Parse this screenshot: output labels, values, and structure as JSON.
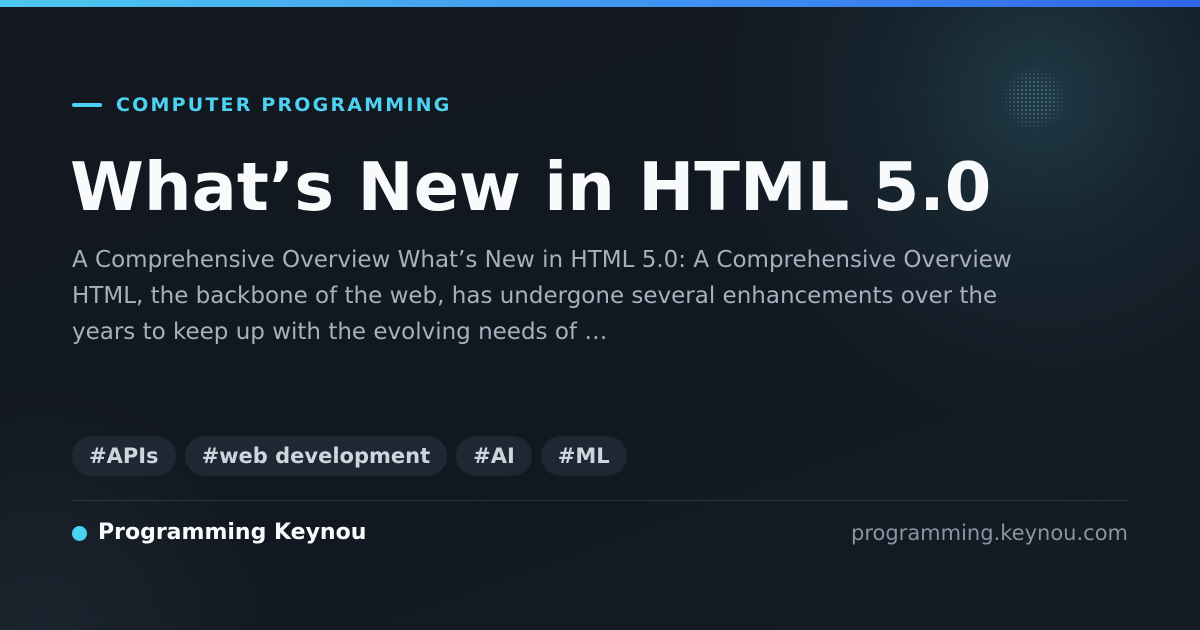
{
  "colors": {
    "background": "#121821",
    "accent": "#49d2f2",
    "top_bar_start": "#4dc8ef",
    "top_bar_end": "#2f66e8",
    "title": "#f8fafc",
    "description": "#a7b0bc",
    "tag_background": "#1e2732",
    "tag_text": "#cdd5df",
    "domain": "#8a95a2"
  },
  "category": {
    "label": "COMPUTER PROGRAMMING"
  },
  "article": {
    "title": "What’s New in HTML 5.0",
    "description": "A Comprehensive Overview What’s New in HTML 5.0: A Comprehensive Overview HTML, the backbone of the web, has undergone several enhancements over the years to keep up with the evolving needs of …"
  },
  "tags": [
    "#APIs",
    "#web development",
    "#AI",
    "#ML"
  ],
  "footer": {
    "brand": "Programming Keynou",
    "domain": "programming.keynou.com"
  }
}
